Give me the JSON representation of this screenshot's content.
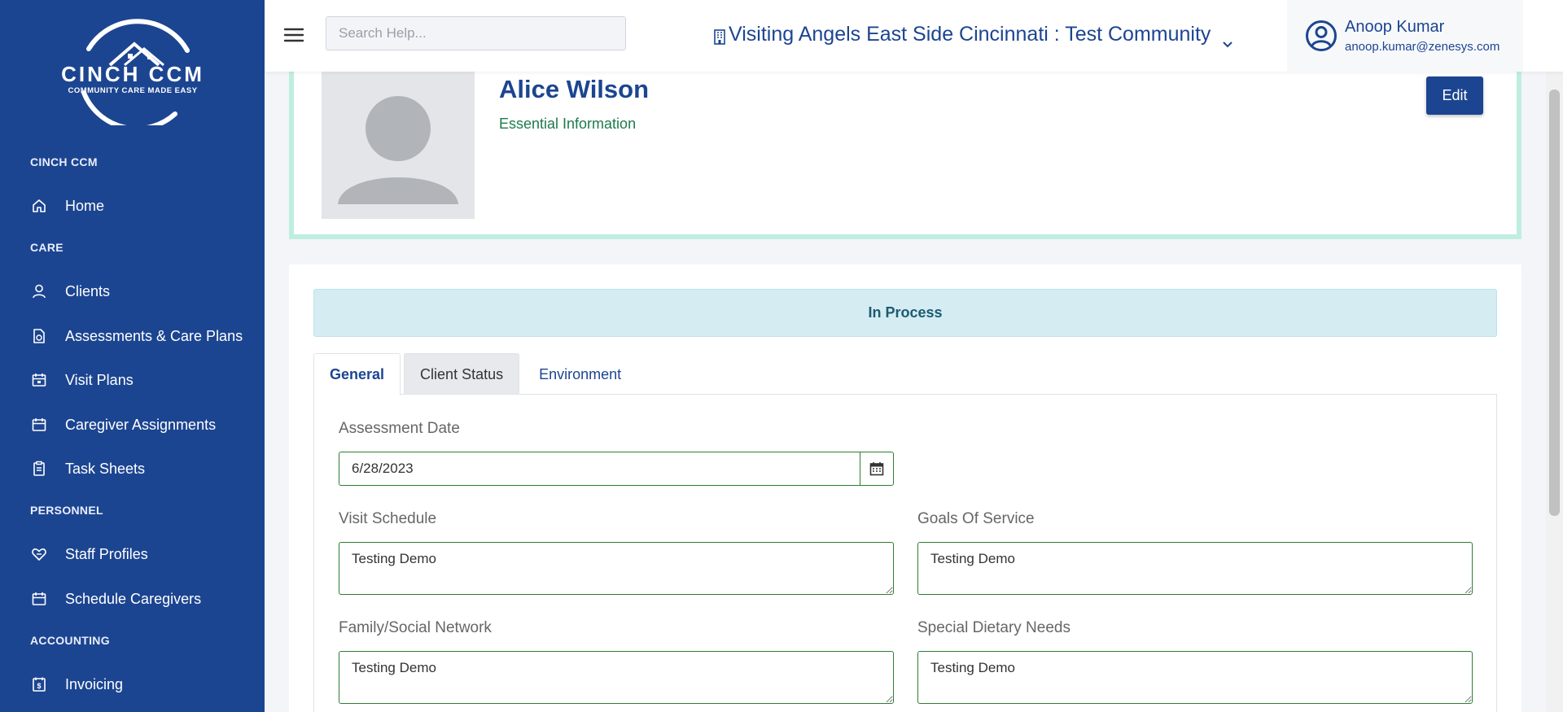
{
  "brand": {
    "logo_text": "CINCH CCM",
    "logo_tagline": "COMMUNITY CARE MADE EASY"
  },
  "sidebar": {
    "sections": [
      {
        "label": "CINCH CCM"
      },
      {
        "label": "CARE"
      },
      {
        "label": "PERSONNEL"
      },
      {
        "label": "ACCOUNTING"
      }
    ],
    "items": [
      {
        "label": "Home",
        "icon": "home-icon"
      },
      {
        "label": "Clients",
        "icon": "user-icon"
      },
      {
        "label": "Assessments & Care Plans",
        "icon": "document-chart-icon"
      },
      {
        "label": "Visit Plans",
        "icon": "calendar-plan-icon"
      },
      {
        "label": "Caregiver Assignments",
        "icon": "calendar-icon"
      },
      {
        "label": "Task Sheets",
        "icon": "clipboard-icon"
      },
      {
        "label": "Staff Profiles",
        "icon": "heart-hand-icon"
      },
      {
        "label": "Schedule Caregivers",
        "icon": "calendar-icon"
      },
      {
        "label": "Invoicing",
        "icon": "invoice-icon"
      }
    ]
  },
  "topbar": {
    "search_placeholder": "Search Help...",
    "community": "Visiting Angels East Side Cincinnati : Test Community",
    "user_name": "Anoop Kumar",
    "user_email": "anoop.kumar@zenesys.com"
  },
  "profile": {
    "name": "Alice Wilson",
    "subtitle": "Essential Information",
    "edit_label": "Edit"
  },
  "main": {
    "status": "In Process",
    "tabs": [
      {
        "label": "General",
        "active": true
      },
      {
        "label": "Client Status",
        "active": false
      },
      {
        "label": "Environment",
        "active": false
      }
    ],
    "fields": {
      "assessment_date_label": "Assessment Date",
      "assessment_date_value": "6/28/2023",
      "visit_schedule_label": "Visit Schedule",
      "visit_schedule_value": "Testing Demo",
      "goals_label": "Goals Of Service",
      "goals_value": "Testing Demo",
      "family_label": "Family/Social Network",
      "family_value": "Testing Demo",
      "dietary_label": "Special Dietary Needs",
      "dietary_value": "Testing Demo"
    }
  },
  "colors": {
    "sidebar_bg": "#1c4591",
    "accent": "#1c4591",
    "success_border": "#2e7d32",
    "status_bg": "#d5ecf3",
    "profile_border": "#bfeee0"
  }
}
